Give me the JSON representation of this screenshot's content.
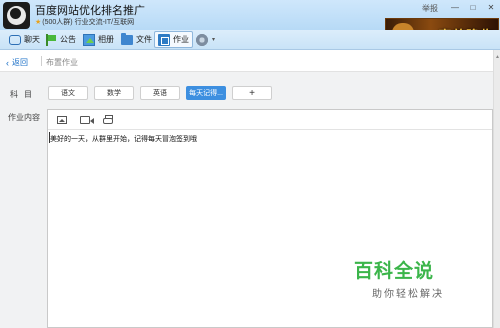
{
  "titlebar": {
    "group_name": "百度网站优化排名推广",
    "group_info": "(500人群) 行业交流-IT/互联网",
    "report_label": "举报",
    "minimize": "—",
    "maximize": "□",
    "close": "✕",
    "banner_text": "魔兽降临"
  },
  "toolbar": {
    "items": [
      {
        "label": "聊天",
        "icon": "chat-icon"
      },
      {
        "label": "公告",
        "icon": "announcement-icon"
      },
      {
        "label": "相册",
        "icon": "album-icon"
      },
      {
        "label": "文件",
        "icon": "folder-icon"
      },
      {
        "label": "作业",
        "icon": "homework-icon",
        "active": true
      }
    ],
    "settings_icon": "gear-icon",
    "settings_caret": "▾"
  },
  "breadcrumb": {
    "back_label": "返回",
    "current": "布置作业"
  },
  "subject": {
    "label": "科目",
    "chips": [
      "语文",
      "数学",
      "英语",
      "每天记得...",
      "+"
    ],
    "selected_index": 3
  },
  "work": {
    "label": "作业内容",
    "tools": [
      "image-icon",
      "video-icon",
      "print-icon"
    ],
    "text": "美好的一天，从群里开始，记得每天冒泡签到哦"
  },
  "watermark": {
    "main": "百科全说",
    "sub": "助你轻松解决"
  },
  "colors": {
    "accent": "#3d8fe0",
    "link": "#1a6fc7",
    "watermark_green": "#3bb54a"
  }
}
